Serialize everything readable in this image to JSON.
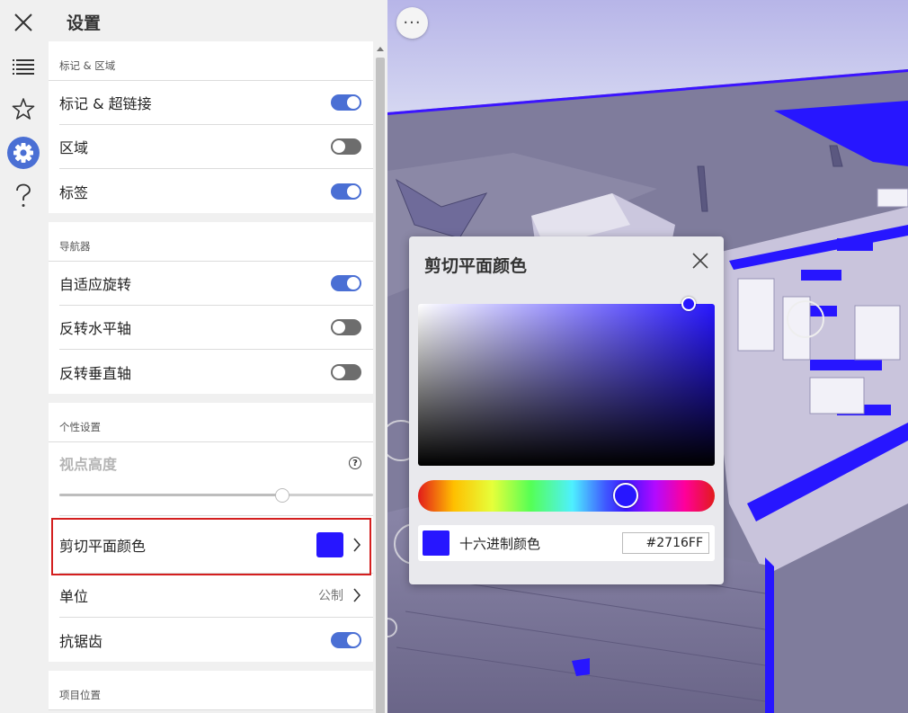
{
  "colors": {
    "accent": "#4a6fd4",
    "clip_color": "#2716FF",
    "highlight": "#d41f1f"
  },
  "rail": [
    {
      "icon": "close-icon"
    },
    {
      "icon": "list-icon"
    },
    {
      "icon": "star-icon"
    },
    {
      "icon": "gear-icon",
      "active": true
    },
    {
      "icon": "help-icon"
    }
  ],
  "panel": {
    "title": "设置",
    "sections": {
      "markup": {
        "header": "标记 & 区域",
        "rows": [
          {
            "label": "标记 & 超链接",
            "on": true
          },
          {
            "label": "区域",
            "on": false
          },
          {
            "label": "标签",
            "on": true
          }
        ]
      },
      "navigator": {
        "header": "导航器",
        "rows": [
          {
            "label": "自适应旋转",
            "on": true
          },
          {
            "label": "反转水平轴",
            "on": false
          },
          {
            "label": "反转垂直轴",
            "on": false
          }
        ]
      },
      "personal": {
        "header": "个性设置",
        "eye_height": {
          "label": "视点高度",
          "help": "?",
          "value_fraction": 0.71
        },
        "clip_color": {
          "label": "剪切平面颜色"
        },
        "units": {
          "label": "单位",
          "value": "公制"
        },
        "antialias": {
          "label": "抗锯齿",
          "on": true
        }
      },
      "project": {
        "header": "项目位置"
      }
    }
  },
  "viewport": {
    "more_label": "···"
  },
  "color_dialog": {
    "title": "剪切平面颜色",
    "hue_fraction": 0.7,
    "hex_label": "十六进制颜色",
    "hex_value": "#2716FF"
  }
}
